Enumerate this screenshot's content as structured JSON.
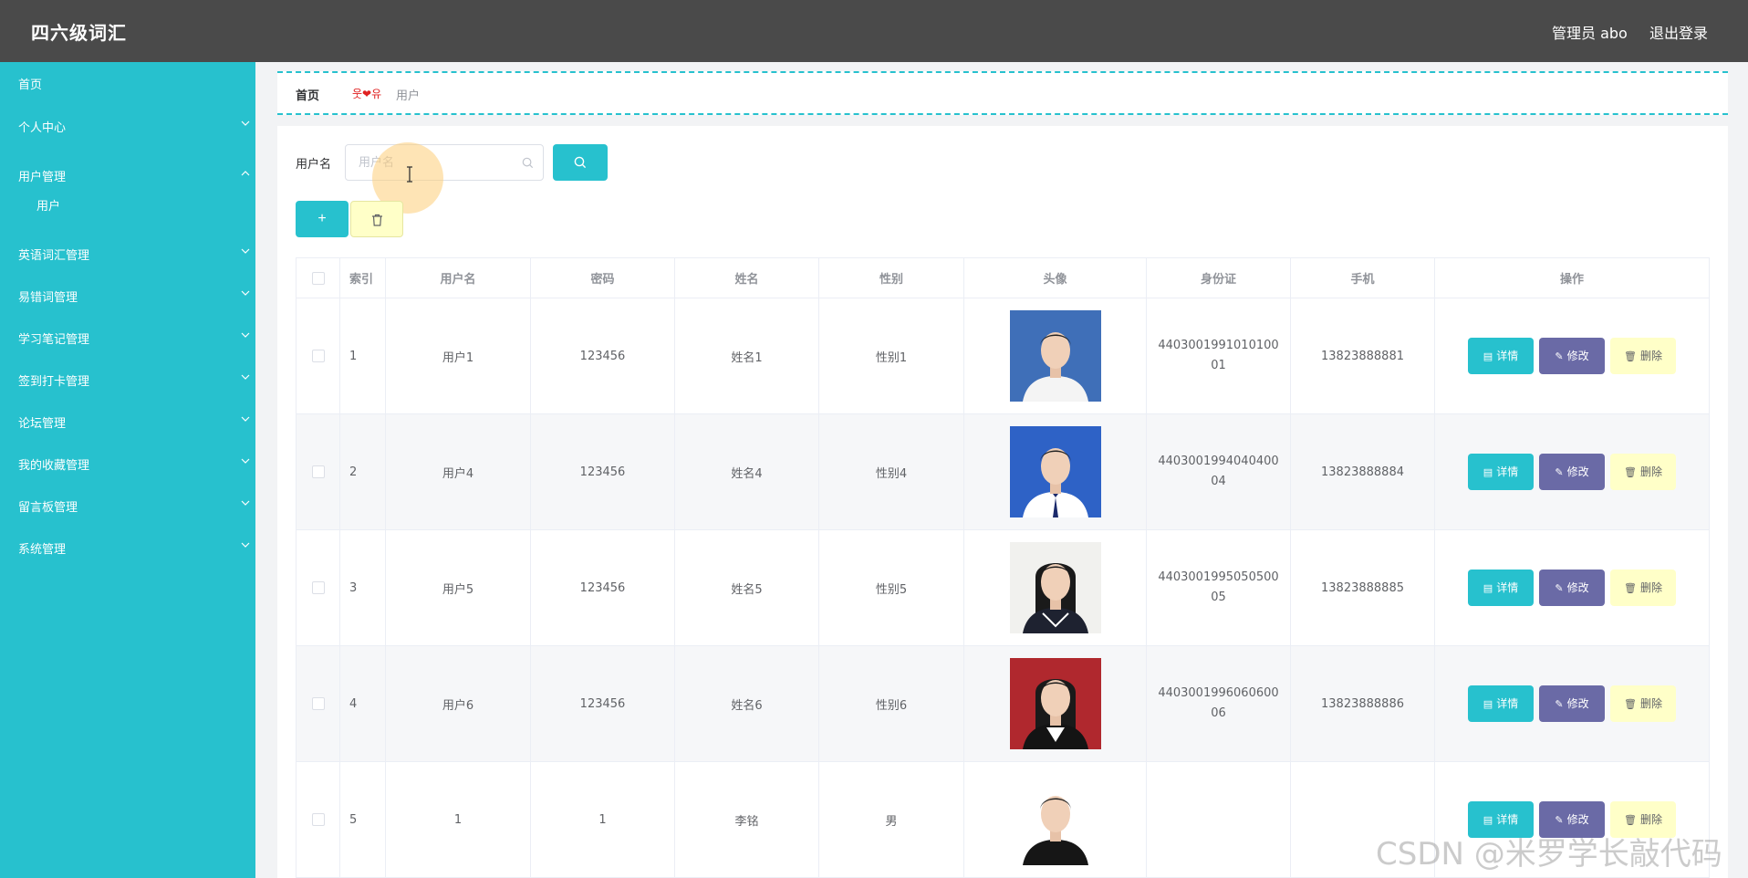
{
  "header": {
    "title": "四六级词汇",
    "admin": "管理员 abo",
    "logout": "退出登录"
  },
  "sidebar": {
    "items": [
      {
        "label": "首页",
        "chevron": false
      },
      {
        "label": "个人中心",
        "chevron": true,
        "dir": "down"
      },
      {
        "label": "用户管理",
        "chevron": true,
        "dir": "up"
      },
      {
        "label": "用户",
        "chevron": false,
        "sub": true
      },
      {
        "label": "英语词汇管理",
        "chevron": true,
        "dir": "down"
      },
      {
        "label": "易错词管理",
        "chevron": true,
        "dir": "down"
      },
      {
        "label": "学习笔记管理",
        "chevron": true,
        "dir": "down"
      },
      {
        "label": "签到打卡管理",
        "chevron": true,
        "dir": "down"
      },
      {
        "label": "论坛管理",
        "chevron": true,
        "dir": "down"
      },
      {
        "label": "我的收藏管理",
        "chevron": true,
        "dir": "down"
      },
      {
        "label": "留言板管理",
        "chevron": true,
        "dir": "down"
      },
      {
        "label": "系统管理",
        "chevron": true,
        "dir": "down"
      }
    ]
  },
  "breadcrumb": {
    "home": "首页",
    "separator": "웃❤유",
    "current": "用户"
  },
  "search": {
    "label": "用户名",
    "placeholder": "用户名",
    "value": ""
  },
  "colors": {
    "accent": "#27c1ce",
    "header": "#4a4a4a",
    "edit": "#6a6aa6",
    "delete": "#ffffc8"
  },
  "table": {
    "headers": [
      "",
      "索引",
      "用户名",
      "密码",
      "姓名",
      "性别",
      "头像",
      "身份证",
      "手机",
      "操作"
    ],
    "actions": {
      "detail": "详情",
      "edit": "修改",
      "delete": "删除"
    },
    "rows": [
      {
        "index": "1",
        "username": "用户1",
        "password": "123456",
        "name": "姓名1",
        "gender": "性别1",
        "avatar": "male-shirt",
        "idcard": "440300199101010001",
        "phone": "13823888881"
      },
      {
        "index": "2",
        "username": "用户4",
        "password": "123456",
        "name": "姓名4",
        "gender": "性别4",
        "avatar": "male-tie",
        "idcard": "440300199404040004",
        "phone": "13823888884"
      },
      {
        "index": "3",
        "username": "用户5",
        "password": "123456",
        "name": "姓名5",
        "gender": "性别5",
        "avatar": "female-sailor",
        "idcard": "440300199505050005",
        "phone": "13823888885"
      },
      {
        "index": "4",
        "username": "用户6",
        "password": "123456",
        "name": "姓名6",
        "gender": "性别6",
        "avatar": "female-red",
        "idcard": "440300199606060006",
        "phone": "13823888886"
      },
      {
        "index": "5",
        "username": "1",
        "password": "1",
        "name": "李铭",
        "gender": "男",
        "avatar": "male-casual",
        "idcard": "",
        "phone": ""
      }
    ]
  },
  "watermark": "CSDN @米罗学长敲代码"
}
